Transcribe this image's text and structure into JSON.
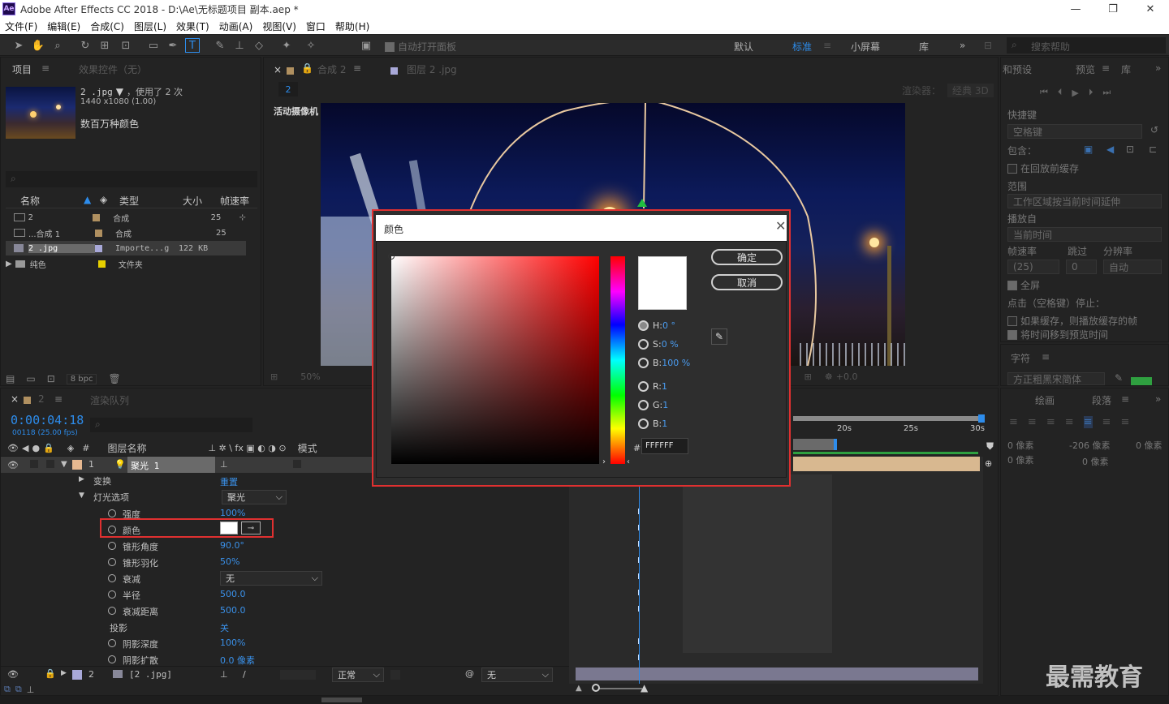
{
  "window": {
    "title": "Adobe After Effects CC 2018 - D:\\Ae\\无标题项目 副本.aep *",
    "logo": "Ae"
  },
  "menu": [
    "文件(F)",
    "编辑(E)",
    "合成(C)",
    "图层(L)",
    "效果(T)",
    "动画(A)",
    "视图(V)",
    "窗口",
    "帮助(H)"
  ],
  "toolbar": {
    "auto_open": "自动打开面板",
    "workspaces": [
      "默认",
      "标准",
      "小屏幕",
      "库"
    ],
    "search_placeholder": "搜索帮助"
  },
  "project": {
    "tab_project": "项目",
    "tab_effects": "效果控件（无）",
    "item_name": "2 .jpg",
    "used": "，使用了 2 次",
    "dims": "1440 x1080 (1.00)",
    "colors": "数百万种颜色",
    "headers": {
      "name": "名称",
      "type": "类型",
      "size": "大小",
      "fps": "帧速率"
    },
    "rows": [
      {
        "name": "2",
        "type": "合成",
        "size": "",
        "fps": "25",
        "color": "#b09060"
      },
      {
        "name": "...合成 1",
        "type": "合成",
        "size": "",
        "fps": "25",
        "color": "#b09060"
      },
      {
        "name": "2 .jpg",
        "type": "Importe...g",
        "size": "122 KB",
        "fps": "",
        "color": "#a8a8d8"
      },
      {
        "name": "纯色",
        "type": "文件夹",
        "size": "",
        "fps": "",
        "color": "#e6d000"
      }
    ],
    "bpc": "8 bpc"
  },
  "composition": {
    "tab": "合成 2",
    "layer_tab": "图层 2 .jpg",
    "comp_name": "2",
    "renderer_label": "渲染器：",
    "renderer_value": "经典 3D",
    "camera_label": "活动摄像机",
    "zoom": "50%",
    "exposure": "+0.0"
  },
  "timeline": {
    "tab": "2",
    "render_queue": "渲染队列",
    "timecode": "0:00:04:18",
    "frames": "00118 (25.00 fps)",
    "col_layer_name": "图层名称",
    "col_mode": "模式",
    "layer1": {
      "num": "1",
      "name": "聚光 1"
    },
    "transform": "变换",
    "transform_reset": "重置",
    "light_options": "灯光选项",
    "light_type": "聚光",
    "props": [
      {
        "name": "强度",
        "value": "100%"
      },
      {
        "name": "颜色",
        "value": ""
      },
      {
        "name": "锥形角度",
        "value": "90.0°"
      },
      {
        "name": "锥形羽化",
        "value": "50%"
      },
      {
        "name": "衰减",
        "value": "无"
      },
      {
        "name": "半径",
        "value": "500.0"
      },
      {
        "name": "衰减距离",
        "value": "500.0"
      },
      {
        "name": "投影",
        "value": "关"
      },
      {
        "name": "阴影深度",
        "value": "100%"
      },
      {
        "name": "阴影扩散",
        "value": "0.0 像素"
      }
    ],
    "layer2": {
      "num": "2",
      "name": "[2 .jpg]",
      "mode": "正常",
      "track": "无"
    },
    "ruler": [
      "20s",
      "25s",
      "30s"
    ]
  },
  "preview": {
    "tab_presets": "和预设",
    "tab_preview": "预览",
    "tab_lib": "库",
    "shortcut": "快捷键",
    "shortcut_val": "空格键",
    "include": "包含：",
    "cache": "在回放前缓存",
    "range": "范围",
    "range_val": "工作区域按当前时间延伸",
    "play_from": "播放自",
    "play_from_val": "当前时间",
    "fps": "帧速率",
    "skip": "跳过",
    "res": "分辨率",
    "fps_val": "(25)",
    "skip_val": "0",
    "res_val": "自动",
    "fullscreen": "全屏",
    "stop_title": "点击（空格键）停止：",
    "if_cached": "如果缓存，则播放缓存的帧",
    "move_time": "将时间移到预览时间"
  },
  "character": {
    "tab": "字符",
    "font": "方正粗黑宋简体"
  },
  "paragraph": {
    "tab_draw": "绘画",
    "tab_para": "段落",
    "indent1": "0 像素",
    "indent2": "-206 像素",
    "indent3": "0 像素",
    "space1": "0 像素",
    "space2": "0 像素"
  },
  "color_dialog": {
    "title": "颜色",
    "ok": "确定",
    "cancel": "取消",
    "h_label": "H:",
    "h_val": "0 °",
    "s_label": "S:",
    "s_val": "0 %",
    "b_label": "B:",
    "b_val": "100 %",
    "r_label": "R:",
    "r_val": "1",
    "g_label": "G:",
    "g_val": "1",
    "bb_label": "B:",
    "bb_val": "1",
    "hex_label": "#",
    "hex": "FFFFFF"
  },
  "watermark": "最需教育",
  "colors": {
    "highlight": "#e03030",
    "accent": "#2d8ceb",
    "selected_color": "#ffffff"
  }
}
